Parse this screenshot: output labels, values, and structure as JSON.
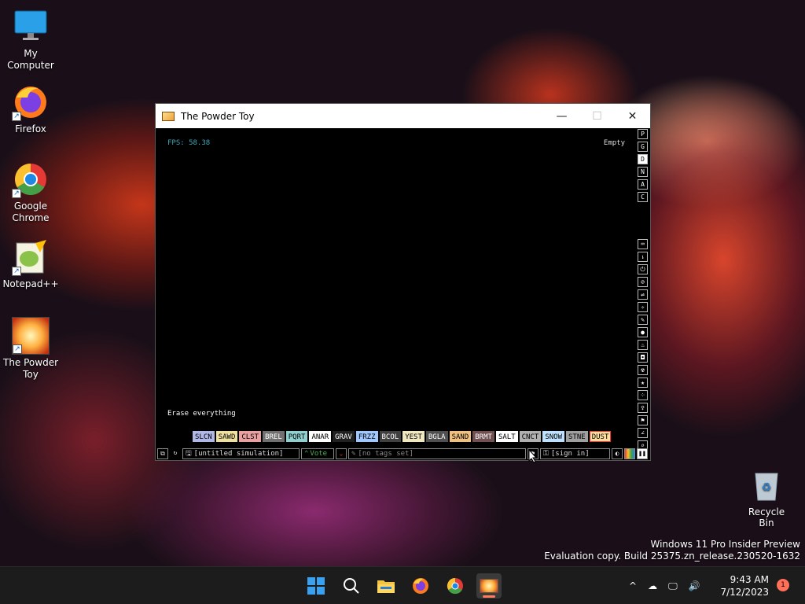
{
  "desktop": {
    "icons": [
      {
        "label": "My Computer"
      },
      {
        "label": "Firefox"
      },
      {
        "label": "Google Chrome"
      },
      {
        "label": "Notepad++"
      },
      {
        "label": "The Powder Toy"
      }
    ],
    "recycle_bin": "Recycle Bin",
    "watermark_line1": "Windows 11 Pro Insider Preview",
    "watermark_line2": "Evaluation copy. Build 25375.zn_release.230520-1632"
  },
  "window": {
    "title": "The Powder Toy",
    "minimize": "—",
    "maximize": "☐",
    "close": "✕"
  },
  "game": {
    "fps": "FPS: 58.38",
    "status": "Empty",
    "tooltip": "Erase everything",
    "right_buttons_top": [
      "P",
      "G",
      "D",
      "N",
      "A",
      "C"
    ],
    "right_buttons_tools": [
      "⌨",
      "⇂",
      "⏻",
      "⊘",
      "⇌",
      "✧",
      "✎",
      "●",
      "♨",
      "◘",
      "☢",
      "★",
      "⁘",
      "♀",
      "⚑",
      "∠",
      "⌕"
    ],
    "elements": [
      {
        "label": "SLCN",
        "color": "#b0b8e8"
      },
      {
        "label": "SAWD",
        "color": "#f0e0a0"
      },
      {
        "label": "CLST",
        "color": "#e8a0a0"
      },
      {
        "label": "BREL",
        "color": "#707070"
      },
      {
        "label": "PQRT",
        "color": "#90d0d0"
      },
      {
        "label": "ANAR",
        "color": "#ffffff"
      },
      {
        "label": "GRAV",
        "color": "#202020"
      },
      {
        "label": "FRZZ",
        "color": "#a0c8ff"
      },
      {
        "label": "BCOL",
        "color": "#404040"
      },
      {
        "label": "YEST",
        "color": "#f0e8c0"
      },
      {
        "label": "BGLA",
        "color": "#505050"
      },
      {
        "label": "SAND",
        "color": "#f0c080"
      },
      {
        "label": "BRMT",
        "color": "#705050"
      },
      {
        "label": "SALT",
        "color": "#ffffff"
      },
      {
        "label": "CNCT",
        "color": "#b0b0b0"
      },
      {
        "label": "SNOW",
        "color": "#c0e0ff"
      },
      {
        "label": "STNE",
        "color": "#a0a0a0"
      },
      {
        "label": "DUST",
        "color": "#ffe0a0"
      }
    ],
    "bottom": {
      "open_icon": "⧉",
      "reload_icon": "↻",
      "save_name": "[untitled simulation]",
      "vote_label": "Vote",
      "tags": "[no tags set]",
      "report_icon": "⚑",
      "sign_in": "[sign in]",
      "render_icon": "◐",
      "pause_icon": "❚❚"
    }
  },
  "taskbar": {
    "time": "9:43 AM",
    "date": "7/12/2023",
    "notifications": "1",
    "tray_icons": [
      "^",
      "☁",
      "🖵",
      "🔊"
    ]
  }
}
